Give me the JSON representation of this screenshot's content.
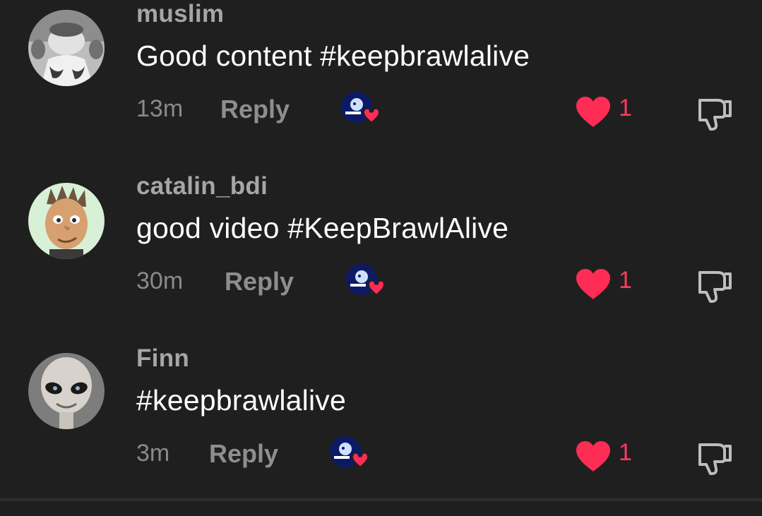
{
  "comments": [
    {
      "username": "muslim",
      "text": "Good content #keepbrawlalive",
      "time": "13m",
      "reply_label": "Reply",
      "likes": "1",
      "avatar_icon": "bw-face-avatar-icon"
    },
    {
      "username": "catalin_bdi",
      "text": "good video #KeepBrawlAlive",
      "time": "30m",
      "reply_label": "Reply",
      "likes": "1",
      "avatar_icon": "cartoon-boy-avatar-icon"
    },
    {
      "username": "Finn",
      "text": "#keepbrawlalive",
      "time": "3m",
      "reply_label": "Reply",
      "likes": "1",
      "avatar_icon": "alien-avatar-icon"
    }
  ],
  "colors": {
    "background": "#1f1f1f",
    "username": "#a6a6a6",
    "text": "#ffffff",
    "meta": "#8a8a8a",
    "like": "#ff3a5f"
  }
}
